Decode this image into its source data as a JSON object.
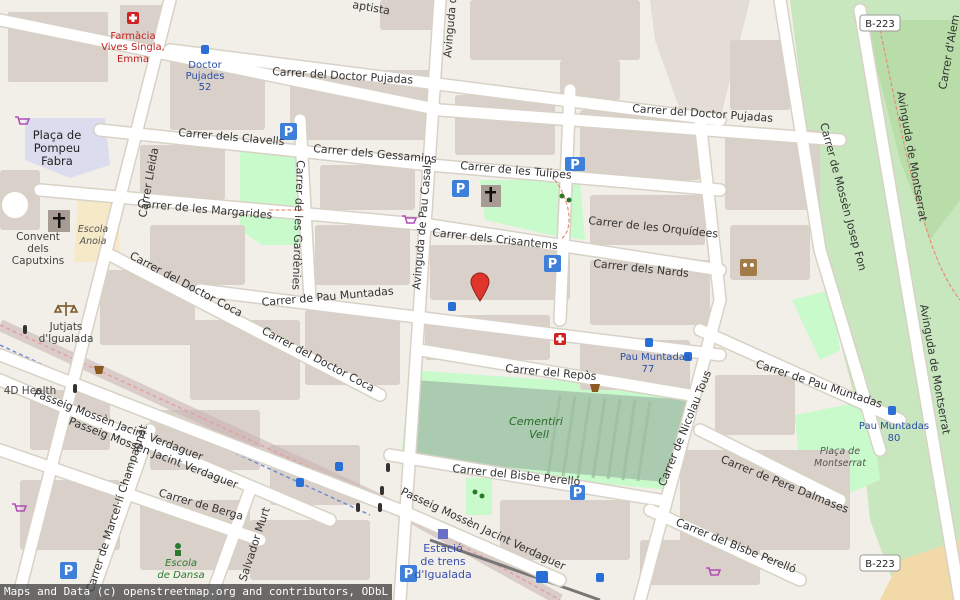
{
  "map": {
    "highways": [
      "B-223",
      "B-223"
    ],
    "streets": {
      "doctor_pujadas_w": "Carrer del Doctor Pujadas",
      "doctor_pujadas_e": "Carrer del Doctor Pujadas",
      "clavells": "Carrer dels Clavells",
      "gessamins": "Carrer dels Gessamins",
      "tulipes": "Carrer de les Tulipes",
      "margarides": "Carrer de les Margarides",
      "orquidees": "Carrer de les Orquídees",
      "crisantems": "Carrer dels Crisantems",
      "nards": "Carrer dels Nards",
      "gardenies": "Carrer de les Gardènies",
      "pau_casals": "Avinguda de Pau Casals",
      "pau_casals_top": "Avinguda d",
      "lleida": "Carrer Lleida",
      "doctor_coca_w": "Carrer del Doctor Coca",
      "doctor_coca_e": "Carrer del Doctor Coca",
      "pau_muntadas_w": "Carrer de Pau Muntadas",
      "pau_muntadas_e": "Carrer de Pau Muntadas",
      "repos": "Carrer del Repòs",
      "mossen_josep_fon": "Carrer de Mossèn Josep Fon",
      "montserrat_1": "Avinguda de Montserrat",
      "montserrat_2": "Avinguda de Montserrat",
      "alemanya": "Carrer d'Alem",
      "jacint_1": "Passeig Mossèn Jacint Verdaguer",
      "jacint_2": "Passeig Mossèn Jacint Verdaguer",
      "jacint_3": "Passeig Mossèn Jacint Verdaguer",
      "bisbe_perello_1": "Carrer del Bisbe Perelló",
      "bisbe_perello_2": "Carrer del Bisbe Perelló",
      "nicolau_tous": "Carrer de Nicolau Tous",
      "pere_dalmases": "Carrer de Pere Dalmases",
      "berga": "Carrer de Berga",
      "marcelli": "Carrer de Marcel·lí Champagnat",
      "salvador_murt": "Salvador Murt",
      "baptista": "aptista"
    },
    "pois": {
      "farmacia_1": "Farmàcia",
      "farmacia_2": "Vives Singla,",
      "farmacia_3": "Emma",
      "stop_pujades_1": "Doctor",
      "stop_pujades_2": "Pujades",
      "stop_pujades_3": "52",
      "placa_pompeu_1": "Plaça de",
      "placa_pompeu_2": "Pompeu",
      "placa_pompeu_3": "Fabra",
      "convent_1": "Convent",
      "convent_2": "dels",
      "convent_3": "Caputxins",
      "escola_anoia_1": "Escola",
      "escola_anoia_2": "Anoia",
      "jutjats_1": "Jutjats",
      "jutjats_2": "d'Igualada",
      "health": "4D Health",
      "stop_muntadas_1": "Pau Muntadas",
      "stop_muntadas_2": "77",
      "stop_muntadas80_1": "Pau Muntadas",
      "stop_muntadas80_2": "80",
      "cementiri_1": "Cementiri",
      "cementiri_2": "Vell",
      "placa_montserrat_1": "Plaça de",
      "placa_montserrat_2": "Montserrat",
      "estacio_1": "Estació",
      "estacio_2": "de trens",
      "estacio_3": "d'Igualada",
      "escola_dansa_1": "Escola",
      "escola_dansa_2": "de Dansa",
      "p_sign": "P"
    },
    "attribution": "Maps and Data (c) openstreetmap.org and contributors, ODbL",
    "colors": {
      "background": "#f2efe9",
      "building": "#d9d0c9",
      "road": "#ffffff",
      "road_casing": "#d8d2c6",
      "park": "#c8facc",
      "cemetery": "#aacbaf",
      "parking": "#3d7fd9",
      "marker": "#e0352b",
      "rail": "#9a9a9a"
    }
  }
}
